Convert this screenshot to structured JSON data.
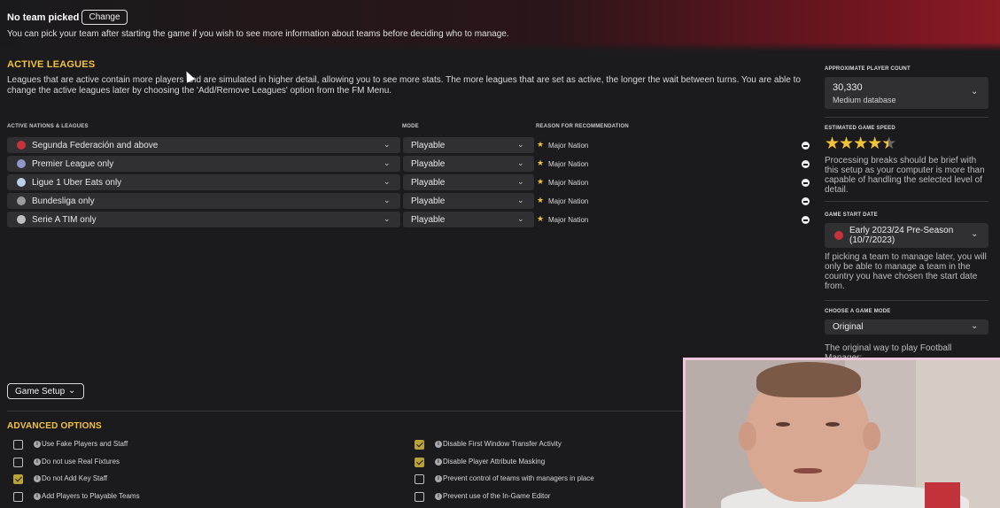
{
  "header": {
    "team_title": "No team picked",
    "change_label": "Change",
    "description": "You can pick your team after starting the game if you wish to see more information about teams before deciding who to manage."
  },
  "active_leagues": {
    "title": "ACTIVE LEAGUES",
    "description": "Leagues that are active contain more players and are simulated in higher detail, allowing you to see more stats. The more leagues that are set as active, the longer the wait between turns. You are able to change the active leagues later by choosing the 'Add/Remove Leagues' option from the FM Menu.",
    "columns": {
      "nations": "ACTIVE NATIONS & LEAGUES",
      "mode": "MODE",
      "reason": "REASON FOR RECOMMENDATION"
    },
    "rows": [
      {
        "league": "Segunda Federación and above",
        "mode": "Playable",
        "reason": "Major Nation",
        "icon": "spain-flag-icon",
        "color": "#c8323a"
      },
      {
        "league": "Premier League only",
        "mode": "Playable",
        "reason": "Major Nation",
        "icon": "england-crest-icon",
        "color": "#8f96c8"
      },
      {
        "league": "Ligue 1 Uber Eats only",
        "mode": "Playable",
        "reason": "Major Nation",
        "icon": "france-crest-icon",
        "color": "#b8d0e8"
      },
      {
        "league": "Bundesliga only",
        "mode": "Playable",
        "reason": "Major Nation",
        "icon": "germany-crest-icon",
        "color": "#9a9a9c"
      },
      {
        "league": "Serie A TIM only",
        "mode": "Playable",
        "reason": "Major Nation",
        "icon": "italy-crest-icon",
        "color": "#c0c0c4"
      }
    ]
  },
  "game_setup": {
    "label": "Game Setup"
  },
  "advanced": {
    "title": "ADVANCED OPTIONS",
    "left": [
      {
        "label": "Use Fake Players and Staff",
        "checked": false
      },
      {
        "label": "Do not use Real Fixtures",
        "checked": false
      },
      {
        "label": "Do not Add Key Staff",
        "checked": true
      },
      {
        "label": "Add Players to Playable Teams",
        "checked": false
      }
    ],
    "right": [
      {
        "label": "Disable First Window Transfer Activity",
        "checked": true
      },
      {
        "label": "Disable Player Attribute Masking",
        "checked": true
      },
      {
        "label": "Prevent control of teams with managers in place",
        "checked": false
      },
      {
        "label": "Prevent use of the In-Game Editor",
        "checked": false
      }
    ]
  },
  "side": {
    "player_count_label": "APPROXIMATE PLAYER COUNT",
    "player_count_value": "30,330",
    "player_count_sub": "Medium database",
    "speed_label": "ESTIMATED GAME SPEED",
    "speed_rating": 4.5,
    "speed_text": "Processing breaks should be brief with this setup as your computer is more than capable of handling the selected level of detail.",
    "start_date_label": "GAME START DATE",
    "start_date_value": "Early 2023/24 Pre-Season (10/7/2023)",
    "start_date_text": "If picking a team to manage later, you will only be able to manage a team in the country you have chosen the start date from.",
    "mode_label": "CHOOSE A GAME MODE",
    "mode_value": "Original",
    "mode_text": "The original way to play Football Manager;"
  },
  "colors": {
    "accent": "#f4c23a",
    "panel": "#303033",
    "background": "#1b1b1d"
  }
}
